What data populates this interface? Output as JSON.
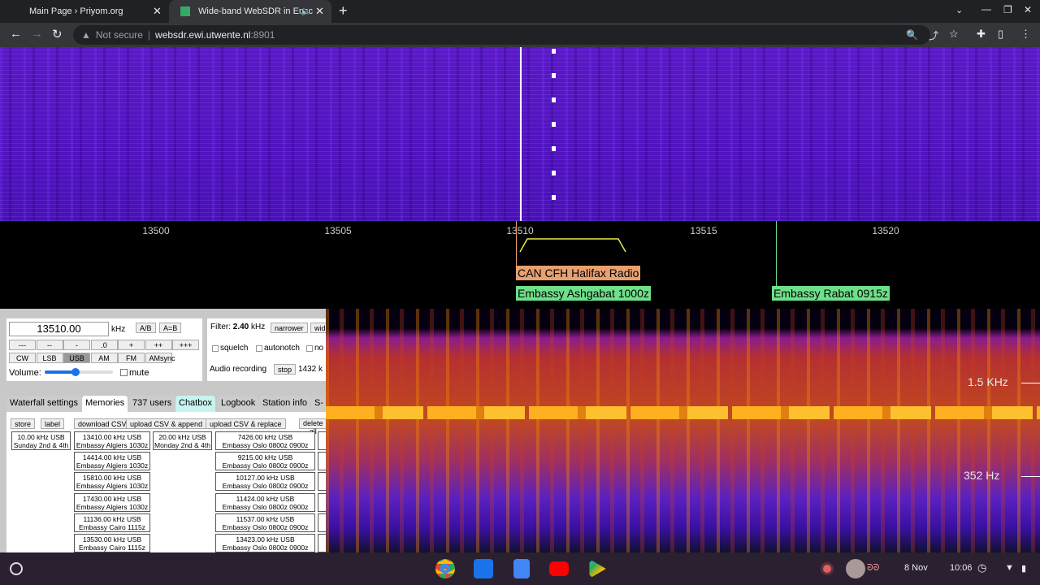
{
  "browser": {
    "tabs": [
      {
        "title": "Main Page › Priyom.org"
      },
      {
        "title": "Wide-band WebSDR in Ensc"
      }
    ],
    "security": "Not secure",
    "url_host": "websdr.ewi.utwente.nl",
    "url_port": ":8901"
  },
  "scale": {
    "ticks": [
      "13500",
      "13505",
      "13510",
      "13515",
      "13520"
    ]
  },
  "stations": [
    {
      "label": "CAN CFH Halifax Radio",
      "color": "#e8a070"
    },
    {
      "label": "Embassy Ashgabat 1000z",
      "color": "#6ee08a"
    },
    {
      "label": "Embassy Rabat 0915z",
      "color": "#6ee08a"
    }
  ],
  "tuning": {
    "frequency": "13510.00",
    "unit": "kHz",
    "ab": "A/B",
    "aeqb": "A=B",
    "steps": [
      "---",
      "--",
      "-",
      ".0",
      "+",
      "++",
      "+++"
    ],
    "modes": [
      "CW",
      "LSB",
      "USB",
      "AM",
      "FM",
      "AMsync"
    ],
    "active_mode": "USB",
    "volume_label": "Volume:",
    "volume": 0.45,
    "mute": "mute"
  },
  "filter": {
    "label": "Filter:",
    "value": "2.40",
    "unit": "kHz",
    "narrower": "narrower",
    "wider": "wid",
    "squelch": "squelch",
    "autonotch": "autonotch",
    "noise": "no",
    "recording": "Audio recording",
    "stop": "stop",
    "rec_size": "1432 k"
  },
  "tabs": [
    "Waterfall settings",
    "Memories",
    "737 users",
    "Chatbox",
    "Logbook",
    "Station info",
    "S-"
  ],
  "memories": {
    "buttons": [
      "store",
      "label",
      "download CSV",
      "upload CSV & append",
      "upload CSV & replace",
      "delete all"
    ],
    "col1": [
      [
        "10.00 kHz USB",
        "Sunday 2nd & 4th"
      ]
    ],
    "col2": [
      [
        "13410.00 kHz USB",
        "Embassy Algiers 1030z"
      ],
      [
        "14414.00 kHz USB",
        "Embassy Algiers 1030z"
      ],
      [
        "15810.00 kHz USB",
        "Embassy Algiers 1030z"
      ],
      [
        "17430.00 kHz USB",
        "Embassy Algiers 1030z"
      ],
      [
        "11136.00 kHz USB",
        "Embassy Cairo 1115z"
      ],
      [
        "13530.00 kHz USB",
        "Embassy Cairo 1115z"
      ]
    ],
    "col3": [
      [
        "20.00 kHz USB",
        "Monday 2nd & 4th"
      ]
    ],
    "col4": [
      [
        "7426.00 kHz USB",
        "Embassy Oslo 0800z 0900z"
      ],
      [
        "9215.00 kHz USB",
        "Embassy Oslo 0800z 0900z"
      ],
      [
        "10127.00 kHz USB",
        "Embassy Oslo 0800z 0900z"
      ],
      [
        "11424.00 kHz USB",
        "Embassy Oslo 0800z 0900z"
      ],
      [
        "11537.00 kHz USB",
        "Embassy Oslo 0800z 0900z"
      ],
      [
        "13423.00 kHz USB",
        "Embassy Oslo 0800z 0900z"
      ]
    ]
  },
  "spectrum": {
    "labels": [
      "1.5 KHz",
      "352 Hz"
    ]
  },
  "taskbar": {
    "date": "8 Nov",
    "time": "10:06"
  }
}
